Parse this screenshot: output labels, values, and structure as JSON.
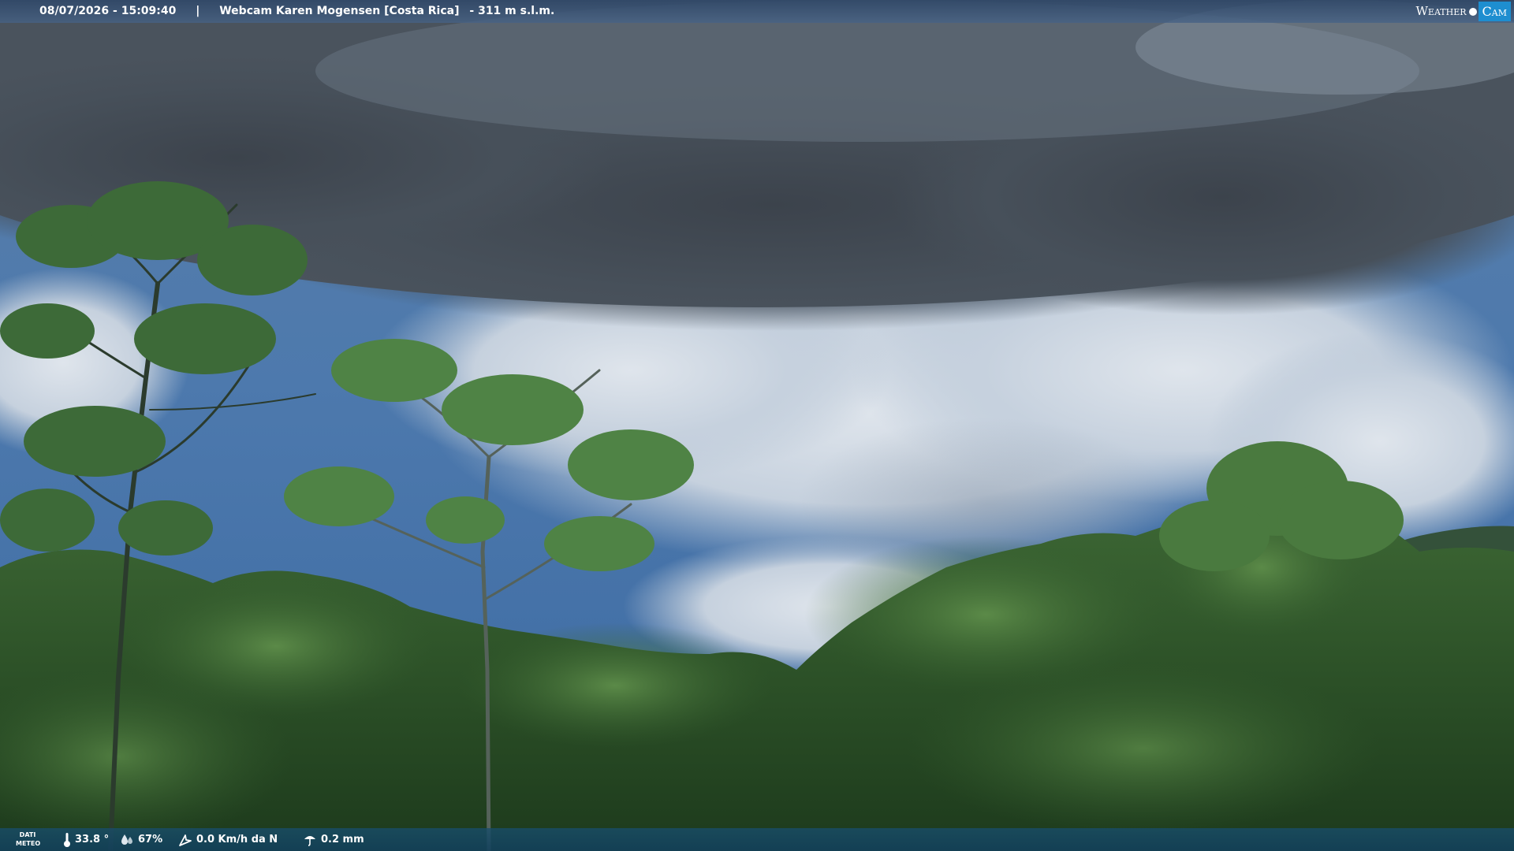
{
  "header": {
    "datetime": "08/07/2026 - 15:09:40",
    "separator": "|",
    "camera_title": "Webcam Karen Mogensen [Costa Rica]",
    "altitude": "- 311 m s.l.m."
  },
  "logo": {
    "part1": "Weather",
    "part2": "Cam"
  },
  "weather_bar": {
    "label_line1": "DATI",
    "label_line2": "METEO",
    "temperature": "33.8 °",
    "humidity": "67%",
    "wind": "0.0 Km/h da N",
    "rain": "0.2 mm",
    "icons": [
      "thermometer-icon",
      "humidity-icon",
      "wind-icon",
      "rain-icon"
    ]
  },
  "colors": {
    "logo_accent": "#1e8ed0",
    "bar_bg": "#184e6c",
    "text": "#ffffff"
  }
}
